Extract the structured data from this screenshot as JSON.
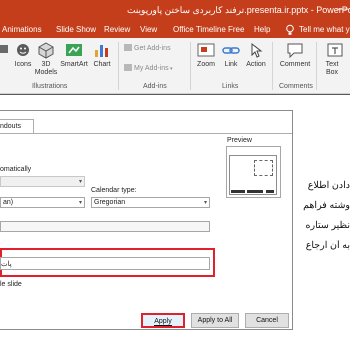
{
  "window": {
    "title": "ترفند کاربردی ساختن پاورپوینت.presenta.ir.pptx  -  PowerPoint",
    "minimize_glyph": "—"
  },
  "tabs": [
    "Animations",
    "Slide Show",
    "Review",
    "View",
    "Office Timeline Free",
    "Help"
  ],
  "tell_me": "Tell me what you",
  "ribbon": {
    "buttons": [
      "Icons",
      "3D Models",
      "SmartArt",
      "Chart"
    ],
    "addins": [
      "Get Add-ins",
      "My Add-ins"
    ],
    "links_buttons": [
      "Zoom",
      "Link",
      "Action"
    ],
    "comment": "Comment",
    "text_box": "Text Box",
    "groups": {
      "illustrations": "Illustrations",
      "addins": "Add-ins",
      "links": "Links",
      "comments": "Comments"
    }
  },
  "slide_text": [
    "دادن اطلاع",
    "وشته فراهم",
    "نظیر ستاره",
    "به آن ارجاع"
  ],
  "dialog": {
    "tab_label": "ndouts",
    "auto_label": "omatically",
    "calendar_label": "Calendar type:",
    "language_value": "an)",
    "calendar_value": "Gregorian",
    "footer_value": "پات",
    "title_slide_label": "le slide",
    "preview_label": "Preview",
    "buttons": {
      "apply": "Apply",
      "apply_all": "Apply to All",
      "cancel": "Cancel"
    }
  },
  "colors": {
    "accent": "#c43e1c",
    "highlight": "#e0212c"
  }
}
